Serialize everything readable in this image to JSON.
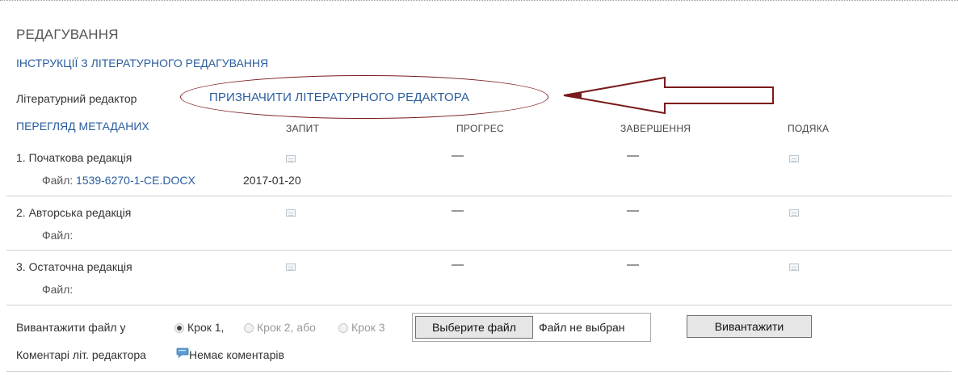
{
  "section": {
    "title": "РЕДАГУВАННЯ",
    "instructions_link": "ІНСТРУКЦІЇ З ЛІТЕРАТУРНОГО РЕДАГУВАННЯ",
    "editor_label": "Літературний редактор",
    "assign_link": "ПРИЗНАЧИТИ ЛІТЕРАТУРНОГО РЕДАКТОРА",
    "metadata_link": "ПЕРЕГЛЯД МЕТАДАНИХ"
  },
  "columns": {
    "request": "ЗАПИТ",
    "progress": "ПРОГРЕС",
    "complete": "ЗАВЕРШЕННЯ",
    "acknowledge": "ПОДЯКА"
  },
  "steps": [
    {
      "label": "1.  Початкова редакція",
      "file_label": "Файл:",
      "file_link": "1539-6270-1-CE.DOCX",
      "file_date": "2017-01-20",
      "progress": "—",
      "complete": "—"
    },
    {
      "label": "2.  Авторська редакція",
      "file_label": "Файл:",
      "progress": "—",
      "complete": "—"
    },
    {
      "label": "3.  Остаточна редакція",
      "file_label": "Файл:",
      "progress": "—",
      "complete": "—"
    }
  ],
  "upload": {
    "label": "Вивантажити файл у",
    "options": [
      "Крок 1,",
      "Крок 2, або",
      "Крок 3"
    ],
    "selected_index": 0,
    "choose_button": "Выберите файл",
    "no_file_text": "Файл не выбран",
    "upload_button": "Вивантажити"
  },
  "comments": {
    "label": "Коментарі літ. редактора",
    "none_text": "Немає коментарів"
  },
  "colors": {
    "link": "#2a5d9f",
    "annotation": "#7a1a1a"
  }
}
